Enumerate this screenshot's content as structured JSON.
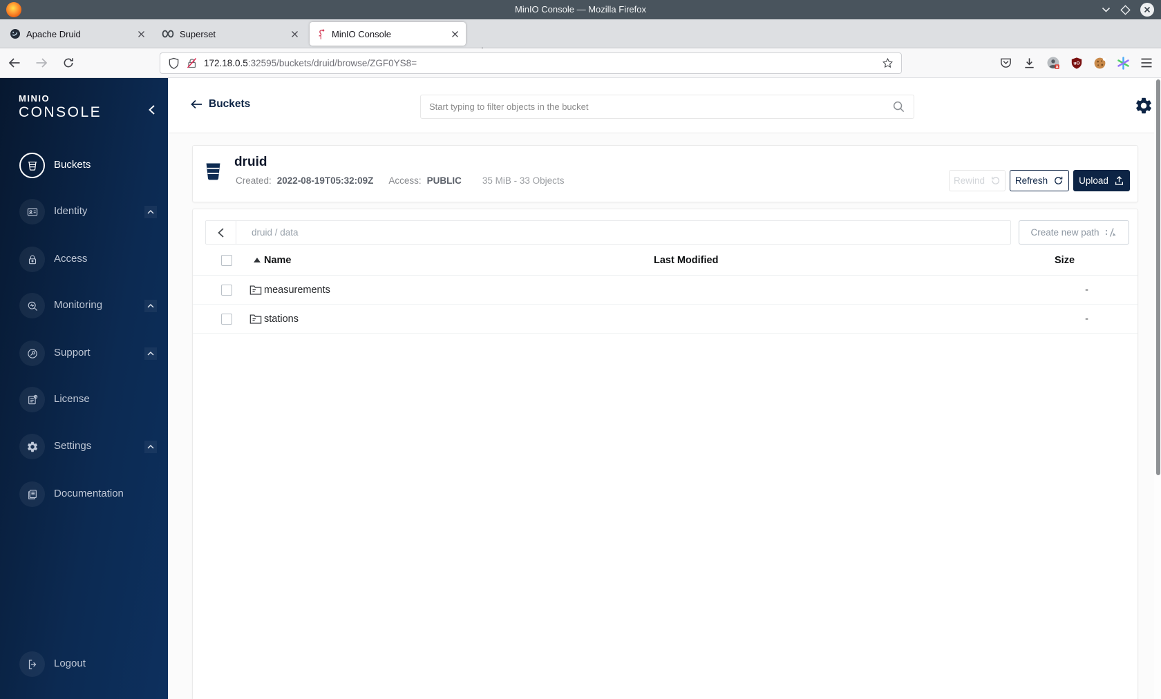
{
  "window": {
    "title": "MinIO Console — Mozilla Firefox"
  },
  "browser": {
    "tabs": [
      {
        "label": "Apache Druid",
        "icon": "druid-favicon",
        "active": false
      },
      {
        "label": "Superset",
        "icon": "superset-favicon",
        "active": false
      },
      {
        "label": "MinIO Console",
        "icon": "minio-flamingo-favicon",
        "active": true
      }
    ],
    "new_tab_label": "+",
    "url": {
      "host": "172.18.0.5",
      "rest": ":32595/buckets/druid/browse/ZGF0YS8="
    }
  },
  "sidebar": {
    "logo_top": "MINIO",
    "logo_bottom": "CONSOLE",
    "items": [
      {
        "label": "Buckets",
        "icon": "bucket-icon",
        "active": true,
        "expandable": false
      },
      {
        "label": "Identity",
        "icon": "identity-icon",
        "active": false,
        "expandable": true
      },
      {
        "label": "Access",
        "icon": "lock-icon",
        "active": false,
        "expandable": false
      },
      {
        "label": "Monitoring",
        "icon": "monitoring-icon",
        "active": false,
        "expandable": true
      },
      {
        "label": "Support",
        "icon": "support-icon",
        "active": false,
        "expandable": true
      },
      {
        "label": "License",
        "icon": "license-icon",
        "active": false,
        "expandable": false
      },
      {
        "label": "Settings",
        "icon": "settings-icon",
        "active": false,
        "expandable": true
      },
      {
        "label": "Documentation",
        "icon": "documentation-icon",
        "active": false,
        "expandable": false
      }
    ],
    "logout_label": "Logout"
  },
  "header": {
    "back_label": "Buckets",
    "search_placeholder": "Start typing to filter objects in the bucket"
  },
  "bucket": {
    "name": "druid",
    "created_label": "Created:",
    "created_value": "2022-08-19T05:32:09Z",
    "access_label": "Access:",
    "access_value": "PUBLIC",
    "summary": "35 MiB - 33 Objects",
    "rewind_label": "Rewind",
    "refresh_label": "Refresh",
    "upload_label": "Upload"
  },
  "browse": {
    "breadcrumb": "druid / data",
    "create_path_label": "Create new path",
    "table": {
      "columns": [
        "Name",
        "Last Modified",
        "Size"
      ],
      "rows": [
        {
          "name": "measurements",
          "type": "folder",
          "last_modified": "",
          "size": "-"
        },
        {
          "name": "stations",
          "type": "folder",
          "last_modified": "",
          "size": "-"
        }
      ]
    }
  },
  "colors": {
    "accent_navy": "#0d2445",
    "sidebar_gradient_start": "#071830",
    "sidebar_gradient_end": "#0d305e",
    "titlebar": "#49545d",
    "ublock_red": "#7a1111"
  }
}
